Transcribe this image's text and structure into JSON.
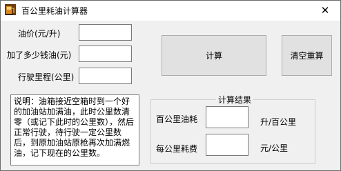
{
  "window": {
    "title": "百公里耗油计算器",
    "close_glyph": "✕"
  },
  "inputs": {
    "oil_price_label": "油价(元/升)",
    "oil_price_value": "",
    "fuel_amount_label": "加了多少钱油(元)",
    "fuel_amount_value": "",
    "distance_label": "行驶里程(公里)",
    "distance_value": ""
  },
  "buttons": {
    "calculate": "计算",
    "reset": "清空重算"
  },
  "note": "说明：油箱接近空箱时到一个好的加油站加满油，此时公里数清零（或记下此时的公里数），然后正常行驶，待行驶一定公里数后，到原加油站原枪再次加满燃油，记下现在的公里数。",
  "results": {
    "group_title": "计算结果",
    "per100_label": "百公里油耗",
    "per100_value": "",
    "per100_unit": "升/百公里",
    "per_km_label": "每公里耗费",
    "per_km_value": "",
    "per_km_unit": "元/公里"
  },
  "icons": {
    "app": "fuel-pump-icon",
    "close": "close-icon"
  }
}
